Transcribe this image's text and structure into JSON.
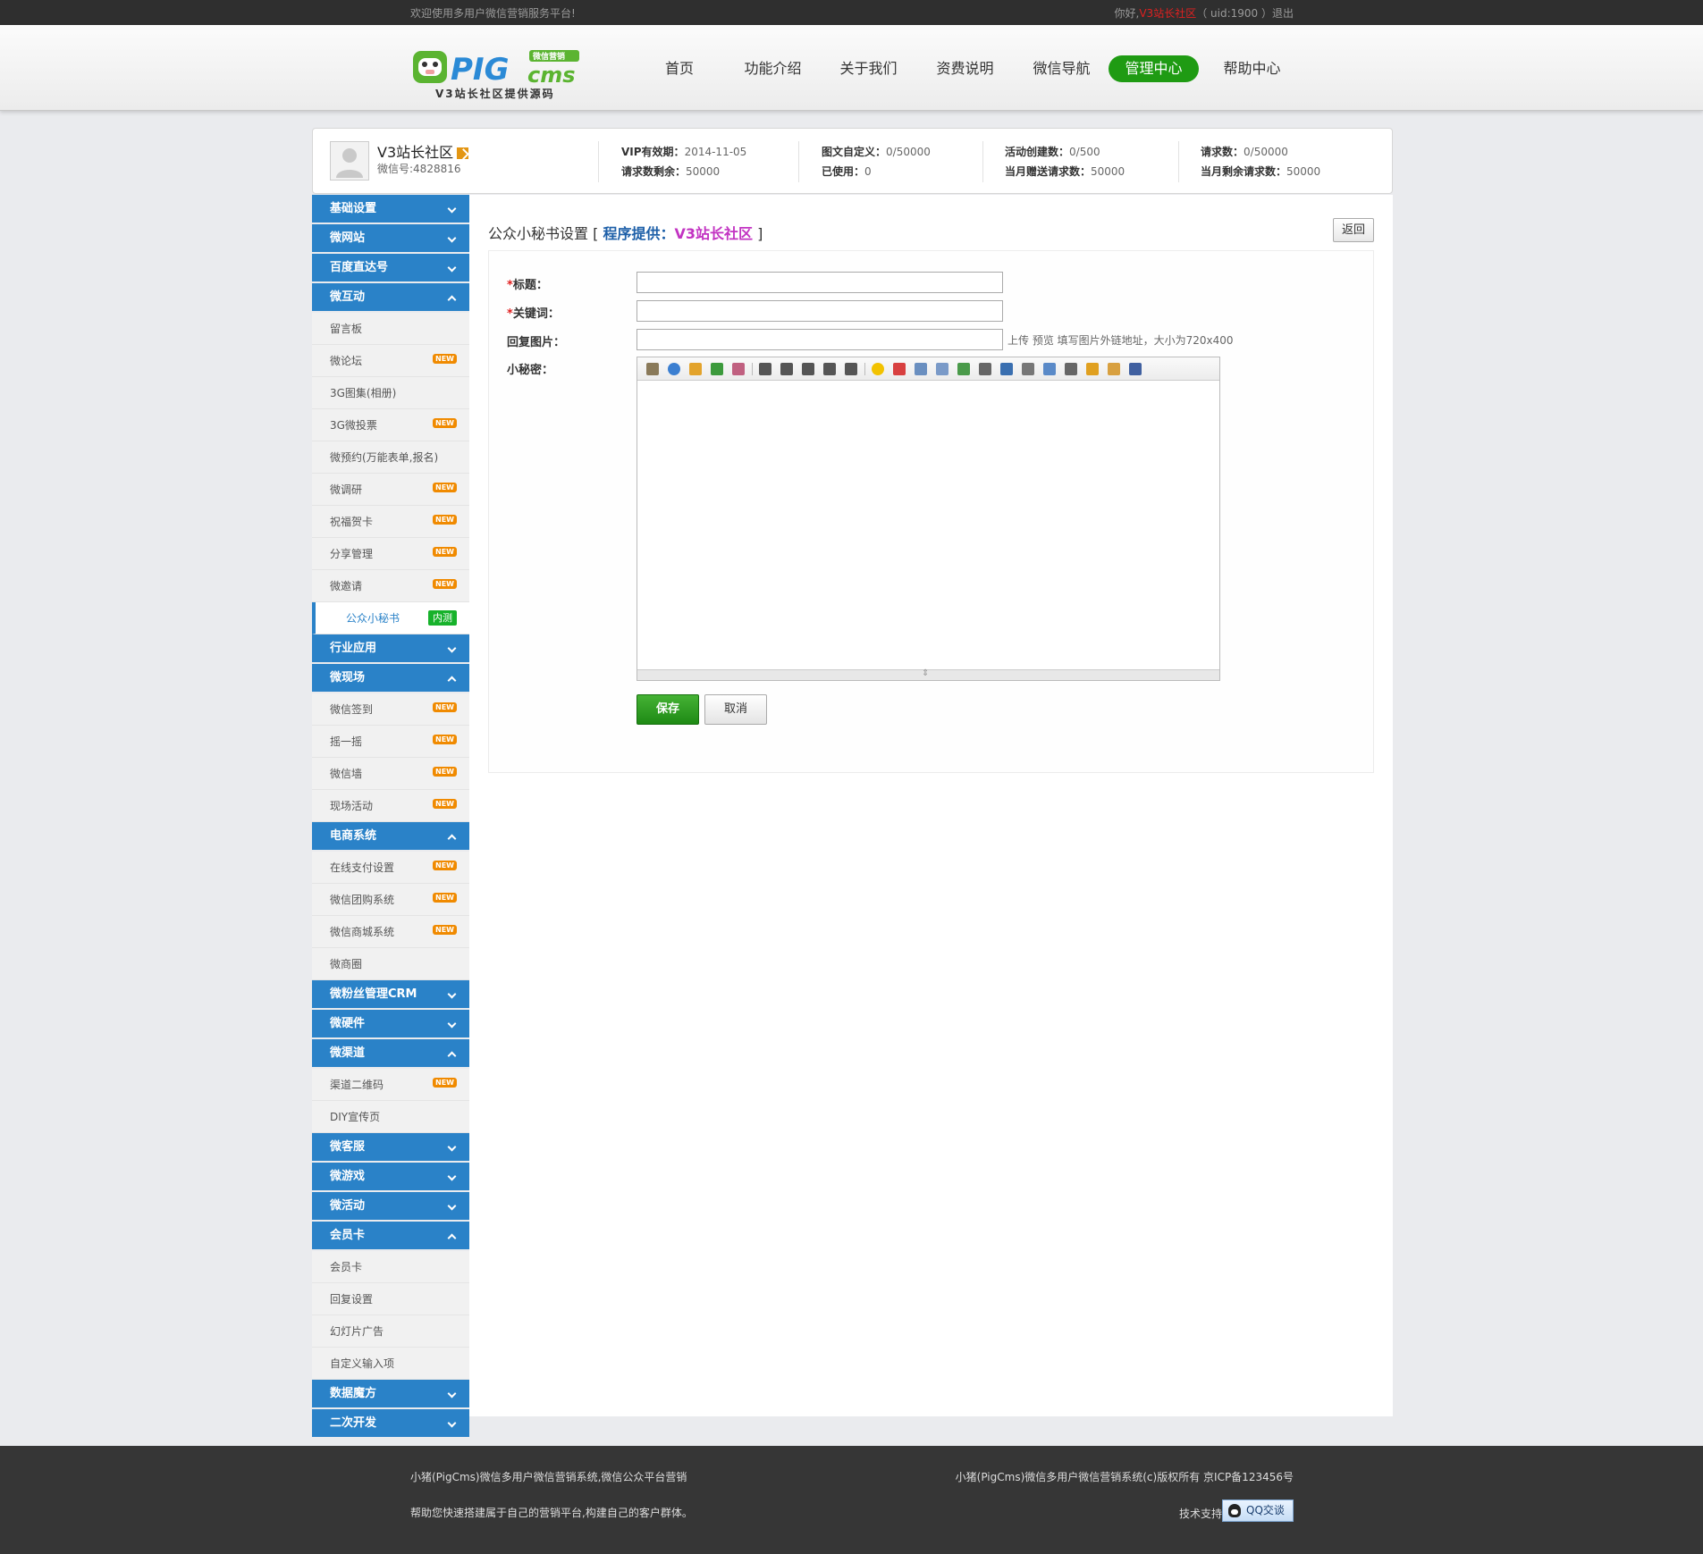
{
  "topbar": {
    "welcome": "欢迎使用多用户微信营销服务平台!",
    "hello": "你好,",
    "username": "V3站长社区",
    "uid": "（ uid:1900 ）",
    "logout": "退出"
  },
  "logo": {
    "main": "PIG",
    "sub": "cms",
    "badge": "微信营销",
    "tagline": "V3站长社区提供源码"
  },
  "nav": [
    {
      "label": "首页"
    },
    {
      "label": "功能介绍"
    },
    {
      "label": "关于我们"
    },
    {
      "label": "资费说明"
    },
    {
      "label": "微信导航"
    },
    {
      "label": "管理中心",
      "active": true
    },
    {
      "label": "帮助中心"
    }
  ],
  "profile": {
    "name": "V3站长社区",
    "wechat": "微信号:4828816",
    "stats": [
      {
        "k1": "VIP有效期：",
        "v1": "2014-11-05",
        "k2": "请求数剩余：",
        "v2": "50000"
      },
      {
        "k1": "图文自定义：",
        "v1": "0/50000",
        "k2": "已使用：",
        "v2": "0"
      },
      {
        "k1": "活动创建数：",
        "v1": "0/500",
        "k2": "当月赠送请求数：",
        "v2": "50000"
      },
      {
        "k1": "请求数：",
        "v1": "0/50000",
        "k2": "当月剩余请求数：",
        "v2": "50000"
      }
    ]
  },
  "sidebar": {
    "groups": [
      {
        "label": "基础设置"
      },
      {
        "label": "微网站"
      },
      {
        "label": "百度直达号"
      },
      {
        "label": "微互动",
        "items": [
          "留言板",
          "微论坛",
          "3G图集(相册)",
          "3G微投票",
          "微预约(万能表单,报名)",
          "微调研",
          "祝福贺卡",
          "分享管理",
          "微邀请",
          "公众小秘书"
        ]
      },
      {
        "label": "行业应用"
      },
      {
        "label": "微现场",
        "items": [
          "微信签到",
          "摇一摇",
          "微信墙",
          "现场活动"
        ]
      },
      {
        "label": "电商系统",
        "items": [
          "在线支付设置",
          "微信团购系统",
          "微信商城系统",
          "微商圈"
        ]
      },
      {
        "label": "微粉丝管理CRM"
      },
      {
        "label": "微硬件"
      },
      {
        "label": "微渠道",
        "items": [
          "渠道二维码",
          "DIY宣传页"
        ]
      },
      {
        "label": "微客服"
      },
      {
        "label": "微游戏"
      },
      {
        "label": "微活动"
      },
      {
        "label": "会员卡",
        "items": [
          "会员卡",
          "回复设置",
          "幻灯片广告",
          "自定义输入项"
        ]
      },
      {
        "label": "数据魔方"
      },
      {
        "label": "二次开发"
      }
    ],
    "tag_new": "NEW",
    "tag_beta": "内测"
  },
  "main": {
    "title": "公众小秘书设置",
    "bracket_open": "[",
    "by_label": "程序提供：",
    "by_site": "V3站长社区",
    "bracket_close": "]",
    "back_button": "返回",
    "form": {
      "title_label": "标题：",
      "keyword_label": "关键词：",
      "image_label": "回复图片：",
      "content_label": "小秘密：",
      "image_hint": "上传 预览 填写图片外链地址，大小为720x400",
      "save": "保存",
      "cancel": "取消"
    }
  },
  "footer": {
    "left1": "小猪(PigCms)微信多用户微信营销系统,微信公众平台营销",
    "left2": "帮助您快速搭建属于自己的营销平台,构建自己的客户群体。",
    "right1": "小猪(PigCms)微信多用户微信营销系统(c)版权所有 京ICP备123456号",
    "support": "技术支持：",
    "qq": "QQ交谈"
  }
}
